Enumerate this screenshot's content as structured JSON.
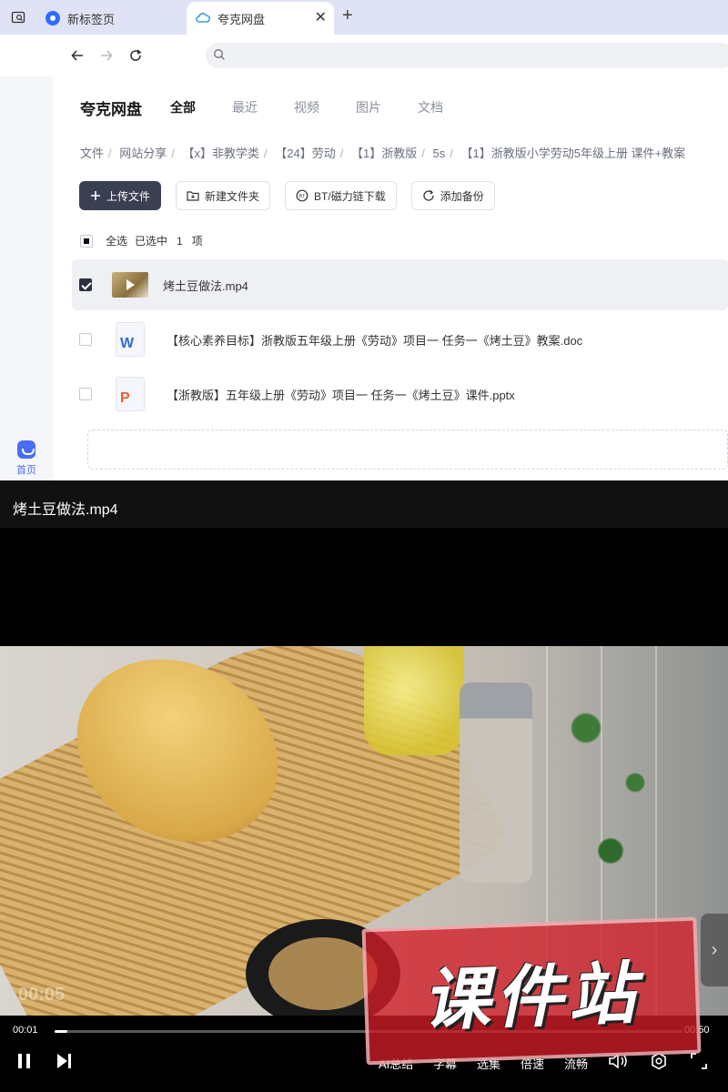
{
  "browser": {
    "tabs": [
      {
        "label": "新标签页",
        "active": false
      },
      {
        "label": "夸克网盘",
        "active": true
      }
    ],
    "address_value": ""
  },
  "rail": {
    "home_label": "首页"
  },
  "header": {
    "brand": "夸克网盘",
    "tabs": [
      "全部",
      "最近",
      "视频",
      "图片",
      "文档"
    ],
    "active_tab": "全部"
  },
  "breadcrumb": [
    "文件",
    "网站分享",
    "【x】非教学类",
    "【24】劳动",
    "【1】浙教版",
    "5s",
    "【1】浙教版小学劳动5年级上册 课件+教案"
  ],
  "actions": {
    "upload": "上传文件",
    "new_folder": "新建文件夹",
    "bt": "BT/磁力链下载",
    "backup": "添加备份"
  },
  "selection": {
    "select_all": "全选",
    "selected_text": "已选中",
    "count": "1",
    "unit": "项"
  },
  "files": [
    {
      "name": "烤土豆做法.mp4",
      "type": "video",
      "checked": true
    },
    {
      "name": "【核心素养目标】浙教版五年级上册《劳动》项目一 任务一《烤土豆》教案.doc",
      "type": "doc",
      "checked": false
    },
    {
      "name": "【浙教版】五年级上册《劳动》项目一 任务一《烤土豆》课件.pptx",
      "type": "ppt",
      "checked": false
    }
  ],
  "player": {
    "title": "烤土豆做法.mp4",
    "current_time": "00:01",
    "duration": "00:50",
    "progress": 0.02,
    "overlay_time": "00:05",
    "options": [
      "AI总结",
      "字幕",
      "选集",
      "倍速",
      "流畅"
    ],
    "watermark": "课件站"
  },
  "colors": {
    "accent": "#4a6cf7",
    "primary_button": "#3b3f52",
    "watermark": "#d21e28"
  }
}
